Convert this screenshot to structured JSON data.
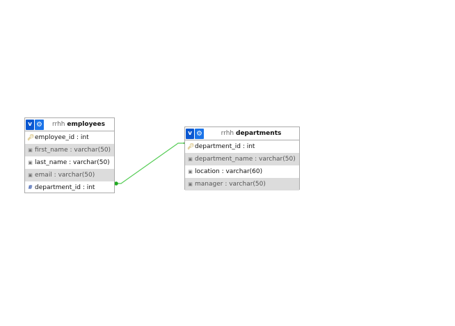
{
  "tables": [
    {
      "id": "employees",
      "db": "rrhh",
      "name": "employees",
      "columns": [
        {
          "label": "employee_id : int",
          "icon": "key-icon",
          "shaded": false
        },
        {
          "label": "first_name : varchar(50)",
          "icon": "column-icon",
          "shaded": true
        },
        {
          "label": "last_name : varchar(50)",
          "icon": "column-icon",
          "shaded": false
        },
        {
          "label": "email : varchar(50)",
          "icon": "column-icon",
          "shaded": true
        },
        {
          "label": "department_id : int",
          "icon": "index-icon",
          "shaded": false
        }
      ]
    },
    {
      "id": "departments",
      "db": "rrhh",
      "name": "departments",
      "columns": [
        {
          "label": "department_id : int",
          "icon": "key-icon",
          "shaded": false
        },
        {
          "label": "department_name : varchar(50)",
          "icon": "column-icon",
          "shaded": true
        },
        {
          "label": "location : varchar(60)",
          "icon": "column-icon",
          "shaded": false
        },
        {
          "label": "manager : varchar(50)",
          "icon": "column-icon",
          "shaded": true
        }
      ]
    }
  ],
  "buttons": {
    "toggle_label": "v",
    "options_icon": "gear-icon"
  },
  "relation": {
    "from": "employees.department_id",
    "to": "departments.department_id",
    "color": "#55cc55"
  },
  "colors": {
    "accent": "#0b57d0",
    "row_shade": "#dcdcdc",
    "border": "#aaaaaa"
  }
}
